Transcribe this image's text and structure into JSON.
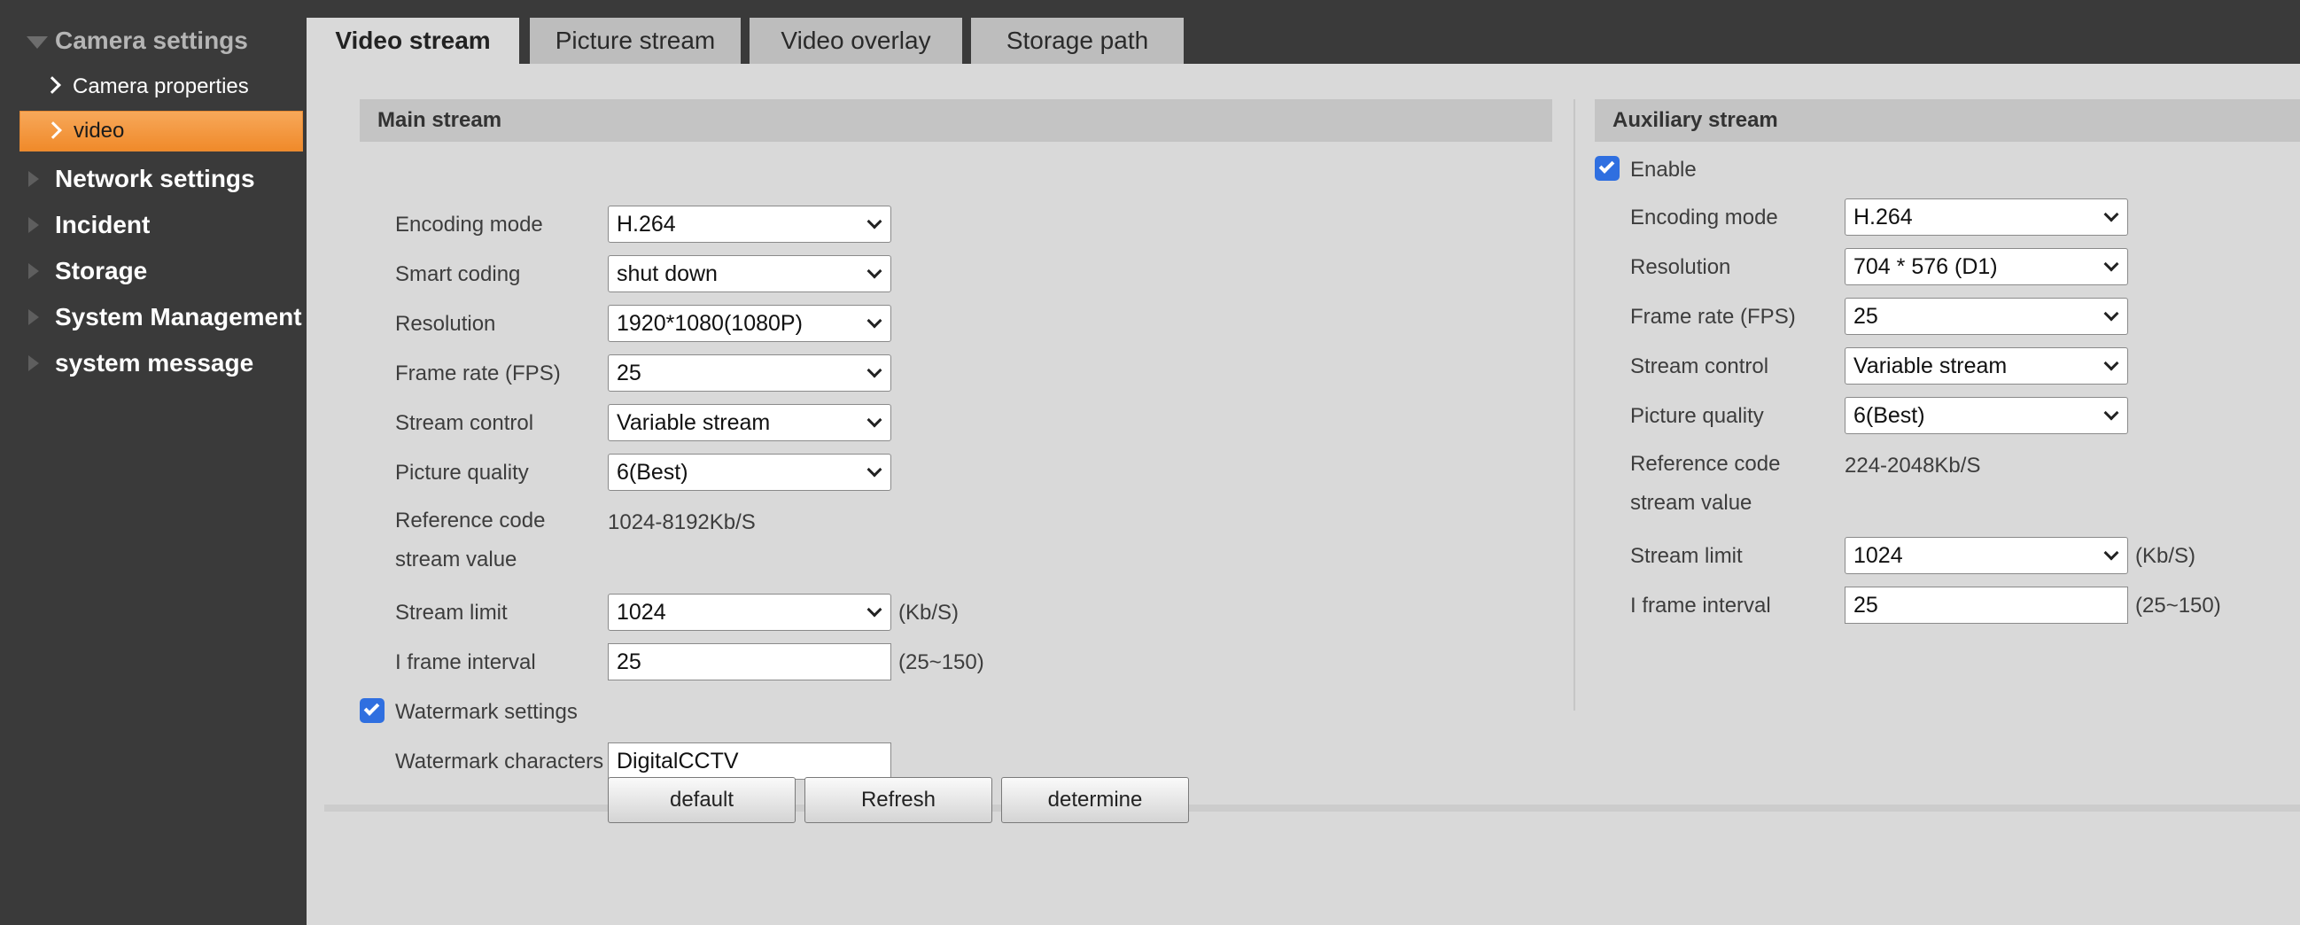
{
  "sidebar": {
    "groups": [
      {
        "label": "Camera settings"
      },
      {
        "label": "Network settings"
      },
      {
        "label": "Incident"
      },
      {
        "label": "Storage"
      },
      {
        "label": "System Management"
      },
      {
        "label": "system message"
      }
    ],
    "sub_items": [
      {
        "label": "Camera properties"
      },
      {
        "label": "video"
      }
    ]
  },
  "tabs": [
    {
      "label": "Video stream"
    },
    {
      "label": "Picture stream"
    },
    {
      "label": "Video overlay"
    },
    {
      "label": "Storage path"
    }
  ],
  "main_stream": {
    "title": "Main stream",
    "encoding_mode": {
      "label": "Encoding mode",
      "value": "H.264"
    },
    "smart_coding": {
      "label": "Smart coding",
      "value": "shut down"
    },
    "resolution": {
      "label": "Resolution",
      "value": "1920*1080(1080P)"
    },
    "frame_rate": {
      "label": "Frame rate (FPS)",
      "value": "25"
    },
    "stream_control": {
      "label": "Stream control",
      "value": "Variable stream"
    },
    "picture_quality": {
      "label": "Picture quality",
      "value": "6(Best)"
    },
    "reference": {
      "label_line1": "Reference code",
      "label_line2": "stream value",
      "value": "1024-8192Kb/S"
    },
    "stream_limit": {
      "label": "Stream limit",
      "value": "1024",
      "unit": "(Kb/S)"
    },
    "iframe_interval": {
      "label": "I frame interval",
      "value": "25",
      "range": "(25~150)"
    },
    "watermark_settings": {
      "label": "Watermark settings",
      "checked": true
    },
    "watermark_characters": {
      "label": "Watermark characters",
      "value": "DigitalCCTV"
    }
  },
  "aux_stream": {
    "title": "Auxiliary stream",
    "enable": {
      "label": "Enable",
      "checked": true
    },
    "encoding_mode": {
      "label": "Encoding mode",
      "value": "H.264"
    },
    "resolution": {
      "label": "Resolution",
      "value": "704 * 576 (D1)"
    },
    "frame_rate": {
      "label": "Frame rate (FPS)",
      "value": "25"
    },
    "stream_control": {
      "label": "Stream control",
      "value": "Variable stream"
    },
    "picture_quality": {
      "label": "Picture quality",
      "value": "6(Best)"
    },
    "reference": {
      "label_line1": "Reference code",
      "label_line2": "stream value",
      "value": "224-2048Kb/S"
    },
    "stream_limit": {
      "label": "Stream limit",
      "value": "1024",
      "unit": "(Kb/S)"
    },
    "iframe_interval": {
      "label": "I frame interval",
      "value": "25",
      "range": "(25~150)"
    }
  },
  "buttons": {
    "default": "default",
    "refresh": "Refresh",
    "determine": "determine"
  },
  "colors": {
    "sidebar_bg": "#3a3a3a",
    "selected_item": "#f39436",
    "checkbox": "#2f6fe0",
    "panel_bg": "#d9d9d9"
  }
}
